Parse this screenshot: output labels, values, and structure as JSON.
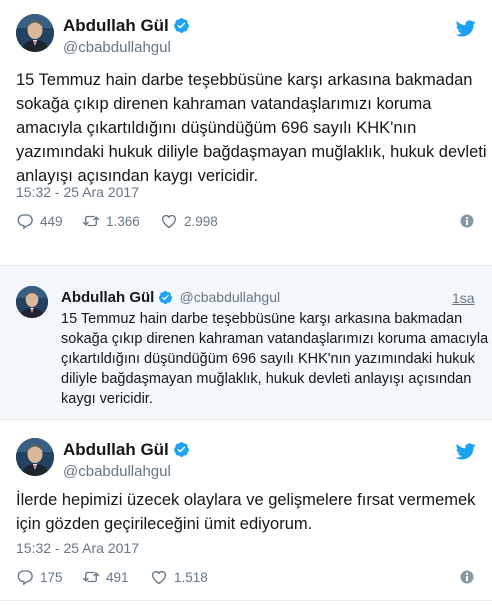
{
  "colors": {
    "accent": "#1da1f2",
    "text": "#14171a",
    "muted": "#657786",
    "border": "#e6ecf0",
    "embed_bg": "#f5f8fa"
  },
  "tweet1": {
    "name": "Abdullah Gül",
    "handle": "@cbabdullahgul",
    "lines": [
      "15 Temmuz hain darbe teşebbüsüne karşı arkasına bakmadan",
      "sokağa çıkıp direnen kahraman vatandaşlarımızı koruma",
      "amacıyla çıkartıldığını düşündüğüm 696 sayılı KHK'nın",
      "yazımındaki hukuk diliyle bağdaşmayan muğlaklık, hukuk devleti",
      "anlayışı açısından kaygı vericidir."
    ],
    "timestamp": "15:32 - 25 Ara 2017",
    "replies": "449",
    "retweets": "1.366",
    "likes": "2.998"
  },
  "embedded": {
    "name": "Abdullah Gül",
    "handle": "@cbabdullahgul",
    "age": "1sa",
    "lines": [
      "15 Temmuz hain darbe teşebbüsüne karşı arkasına bakmadan",
      "sokağa çıkıp direnen kahraman vatandaşlarımızı koruma amacıyla",
      "çıkartıldığını düşündüğüm 696 sayılı KHK'nın yazımındaki hukuk",
      "diliyle bağdaşmayan muğlaklık, hukuk devleti anlayışı açısından",
      "kaygı vericidir."
    ]
  },
  "tweet2": {
    "name": "Abdullah Gül",
    "handle": "@cbabdullahgul",
    "lines": [
      "İlerde hepimizi üzecek olaylara ve gelişmelere fırsat vermemek",
      "için gözden geçirileceğini ümit ediyorum."
    ],
    "timestamp": "15:32 - 25 Ara 2017",
    "replies": "175",
    "retweets": "491",
    "likes": "1.518"
  }
}
